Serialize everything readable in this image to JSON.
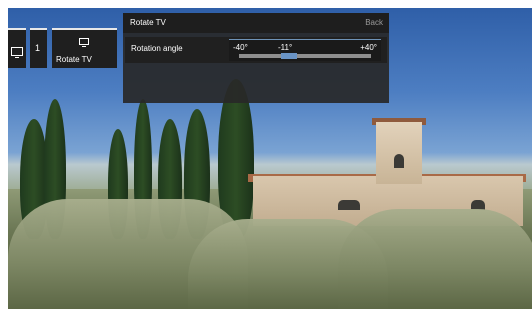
{
  "tiles": {
    "tv_icon": "monitor-icon",
    "number": "1",
    "rotate_icon": "monitor-icon",
    "rotate_label": "Rotate TV"
  },
  "panel": {
    "title": "Rotate TV",
    "back_label": "Back",
    "setting_label": "Rotation angle",
    "slider": {
      "min_label": "-40°",
      "current_label": "-11°",
      "max_label": "+40°",
      "min": -40,
      "max": 40,
      "value": -11
    }
  },
  "colors": {
    "accent": "#6a94c5",
    "panel_bg": "#282828"
  }
}
